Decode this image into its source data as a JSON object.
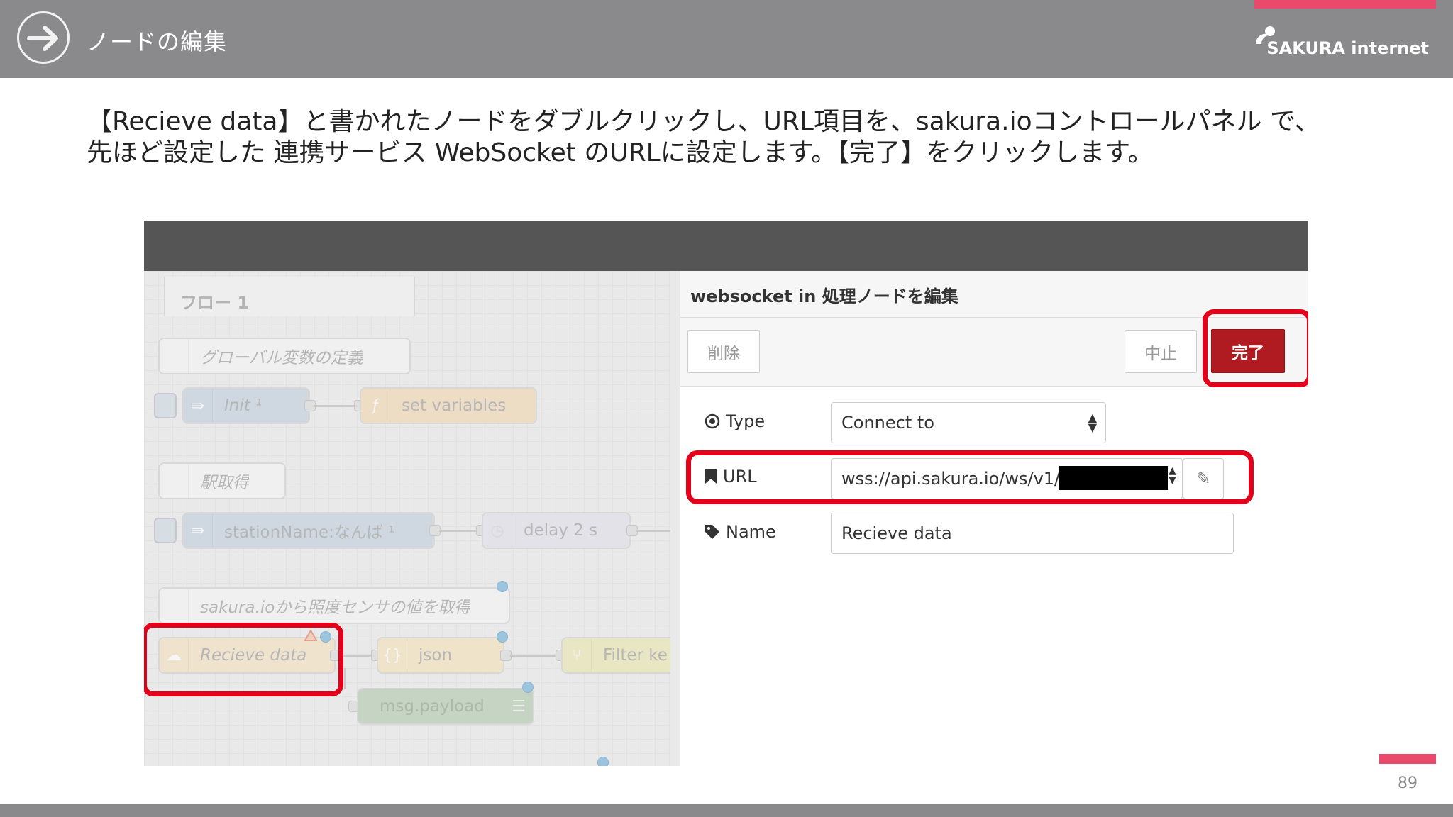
{
  "slide": {
    "title": "ノードの編集",
    "logo_text": "SAKURA internet",
    "instruction_line1": "【Recieve data】と書かれたノードをダブルクリックし、URL項目を、sakura.ioコントロールパネル で、",
    "instruction_line2": "先ほど設定した 連携サービス WebSocket のURLに設定します。【完了】をクリックします。",
    "page_number": "89",
    "accent_color": "#e94a6b",
    "bar_color": "#8a8a8c"
  },
  "editor": {
    "flow_tab": "フロー 1",
    "nodes": {
      "comment_globals": "グローバル変数の定義",
      "init": "Init ¹",
      "set_variables": "set variables",
      "comment_station": "駅取得",
      "station_name": "stationName:なんば ¹",
      "delay": "delay 2 s",
      "comment_sakura": "sakura.ioから照度センサの値を取得",
      "recieve_data": "Recieve data",
      "json": "json",
      "filter": "Filter ke",
      "msg_payload": "msg.payload"
    },
    "panel": {
      "title": "websocket in 処理ノードを編集",
      "delete_label": "削除",
      "cancel_label": "中止",
      "done_label": "完了",
      "type_label": "Type",
      "type_value": "Connect to",
      "url_label": "URL",
      "url_value": "wss://api.sakura.io/ws/v1/7",
      "name_label": "Name",
      "name_value": "Recieve data"
    },
    "highlight_color": "#e4001b",
    "done_color": "#b01b22"
  }
}
